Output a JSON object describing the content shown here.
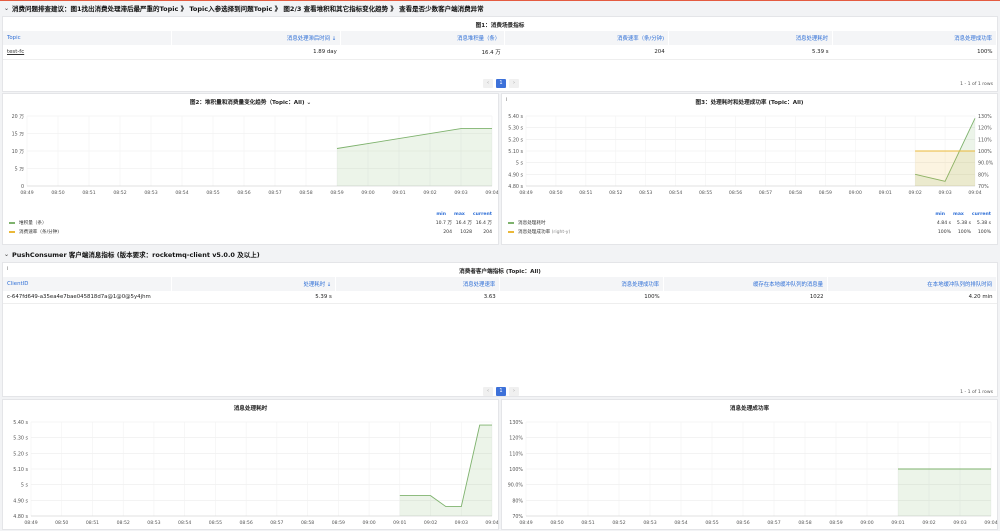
{
  "header_row": {
    "title": "消费问题排查建议：图1找出消费处理滞后最严重的Topic 》 Topic入参选择到问题Topic 》 图2/3 查看堆积和其它指标变化趋势 》 查看是否少数客户端消费异常"
  },
  "panel1": {
    "title": "图1：消费场景指标",
    "columns": [
      "Topic",
      "消息处理滞后时间 ↓",
      "消息堆积量（条）",
      "消费速率（条/分钟)",
      "消息处理耗时",
      "消息处理成功率"
    ],
    "rows": [
      [
        "test-fc",
        "1.89 day",
        "16.4 万",
        "204",
        "5.39 s",
        "100%"
      ]
    ],
    "page": "1",
    "rows_info": "1 - 1 of 1 rows"
  },
  "panel2": {
    "title": "图2：堆积量和消费量变化趋势（Topic：All)",
    "menu_icon": "chevron-down",
    "legend_head": [
      "min",
      "max",
      "current"
    ],
    "legend": [
      {
        "name": "堆积量（条）",
        "min": "10.7 万",
        "max": "16.4 万",
        "current": "16.4 万",
        "color": "#7eb26d"
      },
      {
        "name": "消费速率（条/分钟)",
        "min": "204",
        "max": "1028",
        "current": "204",
        "color": "#eab839"
      }
    ],
    "chart_data": {
      "type": "area",
      "x": [
        "08:49",
        "08:50",
        "08:51",
        "08:52",
        "08:53",
        "08:54",
        "08:55",
        "08:56",
        "08:57",
        "08:58",
        "08:59",
        "09:00",
        "09:01",
        "09:02",
        "09:03",
        "09:04"
      ],
      "yticks": [
        "0",
        "5 万",
        "10 万",
        "15 万",
        "20 万"
      ],
      "ylim": [
        0,
        200000
      ],
      "series": [
        {
          "name": "堆积量（条）",
          "points": [
            [
              "08:59",
              107000
            ],
            [
              "09:03",
              164000
            ],
            [
              "09:04",
              164000
            ]
          ]
        }
      ]
    }
  },
  "panel3": {
    "title": "图3：处理耗时和处理成功率 (Topic：All)",
    "legend_head": [
      "min",
      "max",
      "current"
    ],
    "legend": [
      {
        "name": "消息处理耗时",
        "min": "4.84 s",
        "max": "5.38 s",
        "current": "5.38 s",
        "color": "#7eb26d"
      },
      {
        "name": "消息处理成功率",
        "tag": "(right-y)",
        "min": "100%",
        "max": "100%",
        "current": "100%",
        "color": "#eab839"
      }
    ],
    "chart_data": {
      "type": "line",
      "x": [
        "08:49",
        "08:50",
        "08:51",
        "08:52",
        "08:53",
        "08:54",
        "08:55",
        "08:56",
        "08:57",
        "08:58",
        "08:59",
        "09:00",
        "09:01",
        "09:02",
        "09:03",
        "09:04"
      ],
      "yticks_left": [
        "4.80 s",
        "4.90 s",
        "5 s",
        "5.10 s",
        "5.20 s",
        "5.30 s",
        "5.40 s"
      ],
      "yticks_right": [
        "70%",
        "80%",
        "90.0%",
        "100%",
        "110%",
        "120%",
        "130%"
      ],
      "ylim_left": [
        4.8,
        5.4
      ],
      "ylim_right": [
        70,
        130
      ],
      "series": [
        {
          "name": "消息处理耗时",
          "axis": "left",
          "points": [
            [
              "09:02",
              4.9
            ],
            [
              "09:03",
              4.84
            ],
            [
              "09:04",
              5.38
            ]
          ]
        },
        {
          "name": "消息处理成功率",
          "axis": "right",
          "points": [
            [
              "09:02",
              100
            ],
            [
              "09:03",
              100
            ],
            [
              "09:04",
              100
            ]
          ]
        }
      ]
    }
  },
  "section2": {
    "title": "PushConsumer 客户端消息指标 (版本要求：rocketmq-client v5.0.0 及以上)"
  },
  "panel4": {
    "title": "消费者客户端指标 (Topic：All)",
    "columns": [
      "ClientID",
      "处理耗时 ↓",
      "消息处理速率",
      "消息处理成功率",
      "缓存在本地缓冲队列的消息量",
      "在本地缓冲队列的排队时间"
    ],
    "rows": [
      [
        "c-647fd649-a35ea4e7bae045818d7a@1@0@5y4jhm",
        "5.39 s",
        "3.63",
        "100%",
        "1022",
        "4.20 min"
      ]
    ],
    "page": "1",
    "rows_info": "1 - 1 of 1 rows"
  },
  "panel5": {
    "title": "消息处理耗时",
    "chart_data": {
      "type": "area",
      "x": [
        "08:49",
        "08:50",
        "08:51",
        "08:52",
        "08:53",
        "08:54",
        "08:55",
        "08:56",
        "08:57",
        "08:58",
        "08:59",
        "09:00",
        "09:01",
        "09:02",
        "09:03",
        "09:04"
      ],
      "yticks": [
        "4.80 s",
        "4.90 s",
        "5 s",
        "5.10 s",
        "5.20 s",
        "5.30 s",
        "5.40 s"
      ],
      "ylim": [
        4.8,
        5.4
      ],
      "series": [
        {
          "name": "消息处理耗时",
          "points": [
            [
              "09:01",
              4.93
            ],
            [
              "09:02",
              4.93
            ],
            [
              "09:02.5",
              4.86
            ],
            [
              "09:03",
              4.86
            ],
            [
              "09:03.6",
              5.38
            ],
            [
              "09:04",
              5.38
            ]
          ]
        }
      ]
    }
  },
  "panel6": {
    "title": "消息处理成功率",
    "chart_data": {
      "type": "area",
      "x": [
        "08:49",
        "08:50",
        "08:51",
        "08:52",
        "08:53",
        "08:54",
        "08:55",
        "08:56",
        "08:57",
        "08:58",
        "08:59",
        "09:00",
        "09:01",
        "09:02",
        "09:03",
        "09:04"
      ],
      "yticks": [
        "70%",
        "80%",
        "90.0%",
        "100%",
        "110%",
        "120%",
        "130%"
      ],
      "ylim": [
        70,
        130
      ],
      "series": [
        {
          "name": "消息处理成功率",
          "points": [
            [
              "09:01",
              100
            ],
            [
              "09:04",
              100
            ]
          ]
        }
      ]
    }
  }
}
